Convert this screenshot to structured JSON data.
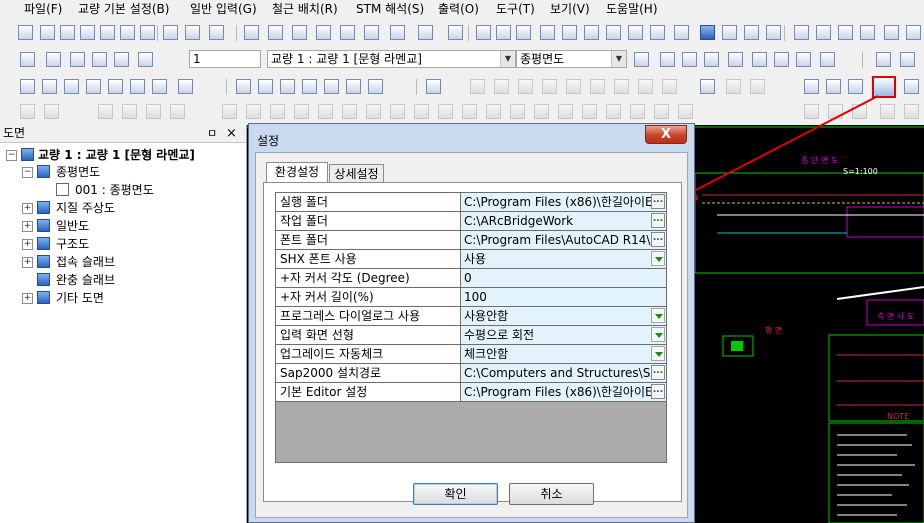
{
  "menu": [
    "파일(F)",
    "교량 기본 설정(B)",
    "일반 입력(G)",
    "철근 배치(R)",
    "STM 해석(S)",
    "출력(O)",
    "도구(T)",
    "보기(V)",
    "도움말(H)"
  ],
  "toolbar": {
    "page_number": "1",
    "bridge_select": "교량 1 : 교량 1 [문형 라멘교]",
    "drawing_select": "종평면도"
  },
  "left_panel": {
    "title": "도면",
    "pin": "ㅁ",
    "close": "×",
    "tree": {
      "root": "교량 1 : 교량 1 [문형 라멘교]",
      "group": "종평면도",
      "doc": "001 : 종평면도",
      "items": [
        "지질 주상도",
        "일반도",
        "구조도",
        "접속 슬래브",
        "완충 슬래브",
        "기타 도면"
      ]
    }
  },
  "dialog": {
    "title": "설정",
    "close_label": "X",
    "tabs": [
      "환경설정",
      "상세설정"
    ],
    "browse_label": "...",
    "rows": [
      {
        "key": "실행 폴더",
        "value": "C:\\Program Files (x86)\\한길아이E",
        "control": "browse"
      },
      {
        "key": "작업 폴더",
        "value": "C:\\ARcBridgeWork",
        "control": "browse"
      },
      {
        "key": "폰트 폴더",
        "value": "C:\\Program Files\\AutoCAD R14\\",
        "control": "browse"
      },
      {
        "key": "SHX 폰트 사용",
        "value": "사용",
        "control": "dropdown"
      },
      {
        "key": "+자 커서 각도 (Degree)",
        "value": "0",
        "control": "none"
      },
      {
        "key": "+자 커서 길이(%)",
        "value": "100",
        "control": "none"
      },
      {
        "key": "프로그레스 다이얼로그 사용",
        "value": "사용안함",
        "control": "dropdown"
      },
      {
        "key": "입력 화면 선형",
        "value": "수평으로 회전",
        "control": "dropdown"
      },
      {
        "key": "업그레이드 자동체크",
        "value": "체크안함",
        "control": "dropdown"
      },
      {
        "key": "Sap2000 설치경로",
        "value": "C:\\Computers and Structures\\SAF",
        "control": "browse"
      },
      {
        "key": "기본 Editor 설정",
        "value": "C:\\Program Files (x86)\\한길아이E",
        "control": "browse"
      }
    ],
    "ok_label": "확인",
    "cancel_label": "취소"
  },
  "cad": {
    "title": "종 단 면 도",
    "scale": "S=1:100",
    "label_plan": "평 면",
    "label_side": "측 면 사 도",
    "label_note": "NOTE"
  },
  "colors": {
    "highlight": "#e00000",
    "cad_background": "#000000",
    "cad_green": "#00c800",
    "grid_value_bg": "#e2f3fc"
  }
}
